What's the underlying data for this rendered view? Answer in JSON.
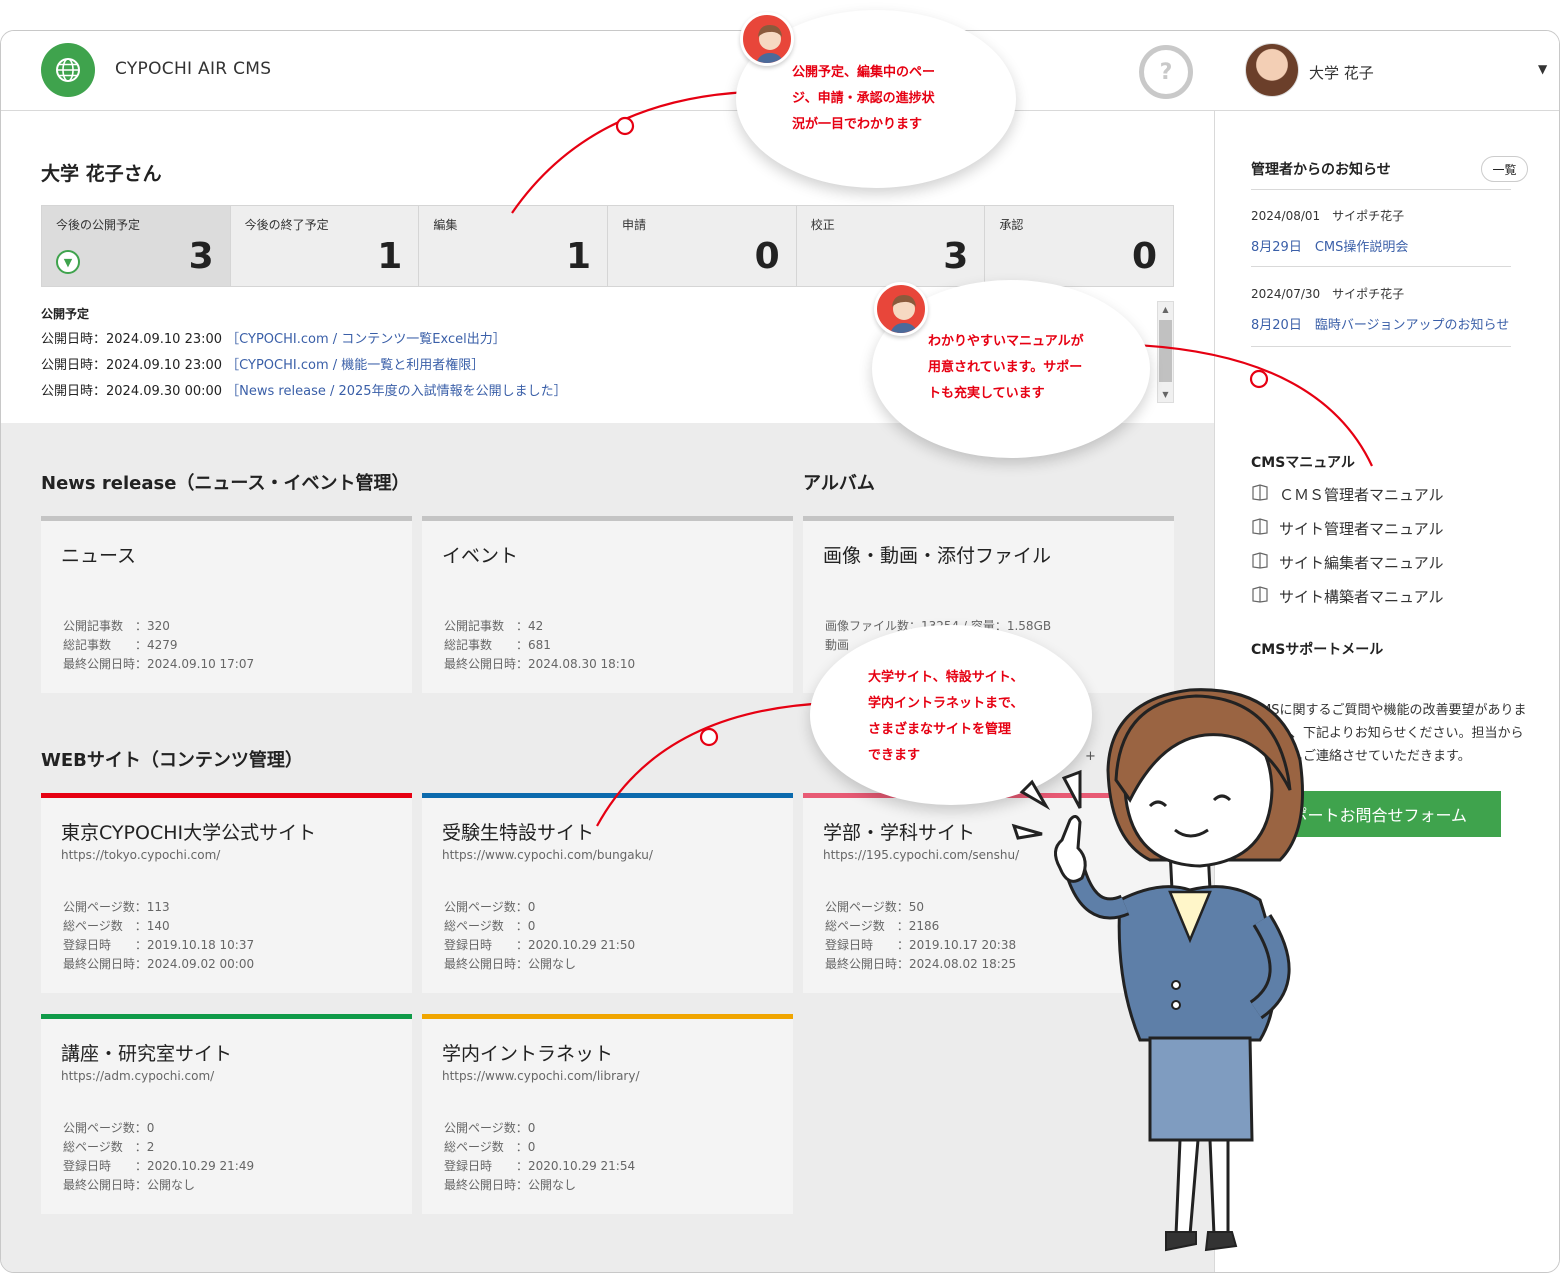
{
  "header": {
    "app_title": "CYPOCHI AIR CMS",
    "help_label": "?",
    "user_name": "大学 花子"
  },
  "greeting": "大学 花子さん",
  "stats": [
    {
      "label": "今後の公開予定",
      "value": "3"
    },
    {
      "label": "今後の終了予定",
      "value": "1"
    },
    {
      "label": "編集",
      "value": "1"
    },
    {
      "label": "申請",
      "value": "0"
    },
    {
      "label": "校正",
      "value": "3"
    },
    {
      "label": "承認",
      "value": "0"
    }
  ],
  "schedule": {
    "heading": "公開予定",
    "items": [
      {
        "prefix": "公開日時：2024.09.10 23:00",
        "link": "［CYPOCHI.com / コンテンツ一覧Excel出力］"
      },
      {
        "prefix": "公開日時：2024.09.10 23:00",
        "link": "［CYPOCHI.com / 機能一覧と利用者権限］"
      },
      {
        "prefix": "公開日時：2024.09.30 00:00",
        "link": "［News release / 2025年度の入試情報を公開しました］"
      }
    ]
  },
  "news_section": {
    "title": "News release（ニュース・イベント管理）",
    "cards": [
      {
        "title": "ニュース",
        "meta": "公開記事数　：320\n総記事数　　：4279\n最終公開日時：2024.09.10 17:07"
      },
      {
        "title": "イベント",
        "meta": "公開記事数　：42\n総記事数　　：681\n最終公開日時：2024.08.30 18:10"
      }
    ]
  },
  "album_section": {
    "title": "アルバム",
    "card": {
      "title": "画像・動画・添付ファイル",
      "meta": "画像ファイル数：13254 / 容量：1.58GB\n動画"
    }
  },
  "web_section": {
    "title": "WEBサイト（コンテンツ管理）",
    "add_label": "+",
    "cards": [
      {
        "title": "東京CYPOCHI大学公式サイト",
        "url": "https://tokyo.cypochi.com/",
        "meta": "公開ページ数：113\n総ページ数　：140\n登録日時　　：2019.10.18 10:37\n最終公開日時：2024.09.02 00:00",
        "color": "#e60012"
      },
      {
        "title": "受験生特設サイト",
        "url": "https://www.cypochi.com/bungaku/",
        "meta": "公開ページ数：0\n総ページ数　：0\n登録日時　　：2020.10.29 21:50\n最終公開日時：公開なし",
        "color": "#0b6aad"
      },
      {
        "title": "学部・学科サイト",
        "url": "https://195.cypochi.com/senshu/",
        "meta": "公開ページ数：50\n総ページ数　：2186\n登録日時　　：2019.10.17 20:38\n最終公開日時：2024.08.02 18:25",
        "color": "#e85a74"
      },
      {
        "title": "講座・研究室サイト",
        "url": "https://adm.cypochi.com/",
        "meta": "公開ページ数：0\n総ページ数　：2\n登録日時　　：2020.10.29 21:49\n最終公開日時：公開なし",
        "color": "#0f9a48"
      },
      {
        "title": "学内イントラネット",
        "url": "https://www.cypochi.com/library/",
        "meta": "公開ページ数：0\n総ページ数　：0\n登録日時　　：2020.10.29 21:54\n最終公開日時：公開なし",
        "color": "#f0a500"
      }
    ]
  },
  "sidebar": {
    "notices_title": "管理者からのお知らせ",
    "list_button": "一覧",
    "notices": [
      {
        "date": "2024/08/01　サイポチ花子",
        "link": "8月29日　CMS操作説明会"
      },
      {
        "date": "2024/07/30　サイポチ花子",
        "link": "8月20日　臨時バージョンアップのお知らせ"
      }
    ],
    "manual_title": "CMSマニュアル",
    "manuals": [
      "ＣＭＳ管理者マニュアル",
      "サイト管理者マニュアル",
      "サイト編集者マニュアル",
      "サイト構築者マニュアル"
    ],
    "support_title": "CMSサポートメール",
    "support_text": "CMSに関するご質問や機能の改善要望がありましたら、下記よりお知らせください。担当から折り返しご連絡させていただきます。",
    "support_button": "サポートお問合せフォーム"
  },
  "callouts": [
    {
      "text_lines": [
        "公開予定、編集中のペー",
        "ジ、申請・承認の進捗状",
        "況が一目でわかります"
      ]
    },
    {
      "text_lines": [
        "わかりやすいマニュアルが",
        "用意されています。サポー",
        "トも充実しています"
      ]
    },
    {
      "text_lines": [
        "大学サイト、特設サイト、",
        "学内イントラネットまで、",
        "さまざまなサイトを管理",
        "できます"
      ]
    }
  ],
  "colors": {
    "accent_green": "#3fa34d",
    "callout_red": "#e60012",
    "link_blue": "#3a5fa8"
  }
}
